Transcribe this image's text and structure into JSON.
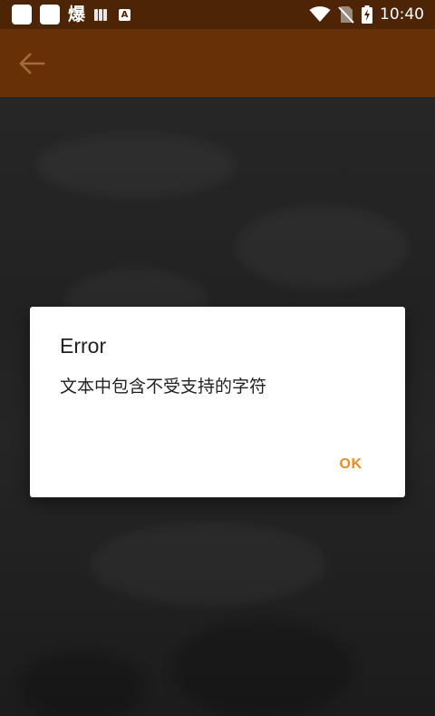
{
  "status_bar": {
    "left_char": "爆",
    "a_badge": "A",
    "time": "10:40",
    "icons": [
      "app-icon",
      "app-icon",
      "book-icon",
      "a-icon",
      "wifi-icon",
      "no-sim-icon",
      "battery-charging-icon"
    ]
  },
  "app_bar": {
    "back_icon": "arrow-left-icon"
  },
  "dialog": {
    "title": "Error",
    "message": "文本中包含不受支持的字符",
    "ok_label": "OK"
  },
  "colors": {
    "status_bar": "#4d2506",
    "app_bar": "#673006",
    "accent": "#ef8a1c",
    "scrim": "#1f1f1f",
    "dialog_bg": "#ffffff"
  }
}
